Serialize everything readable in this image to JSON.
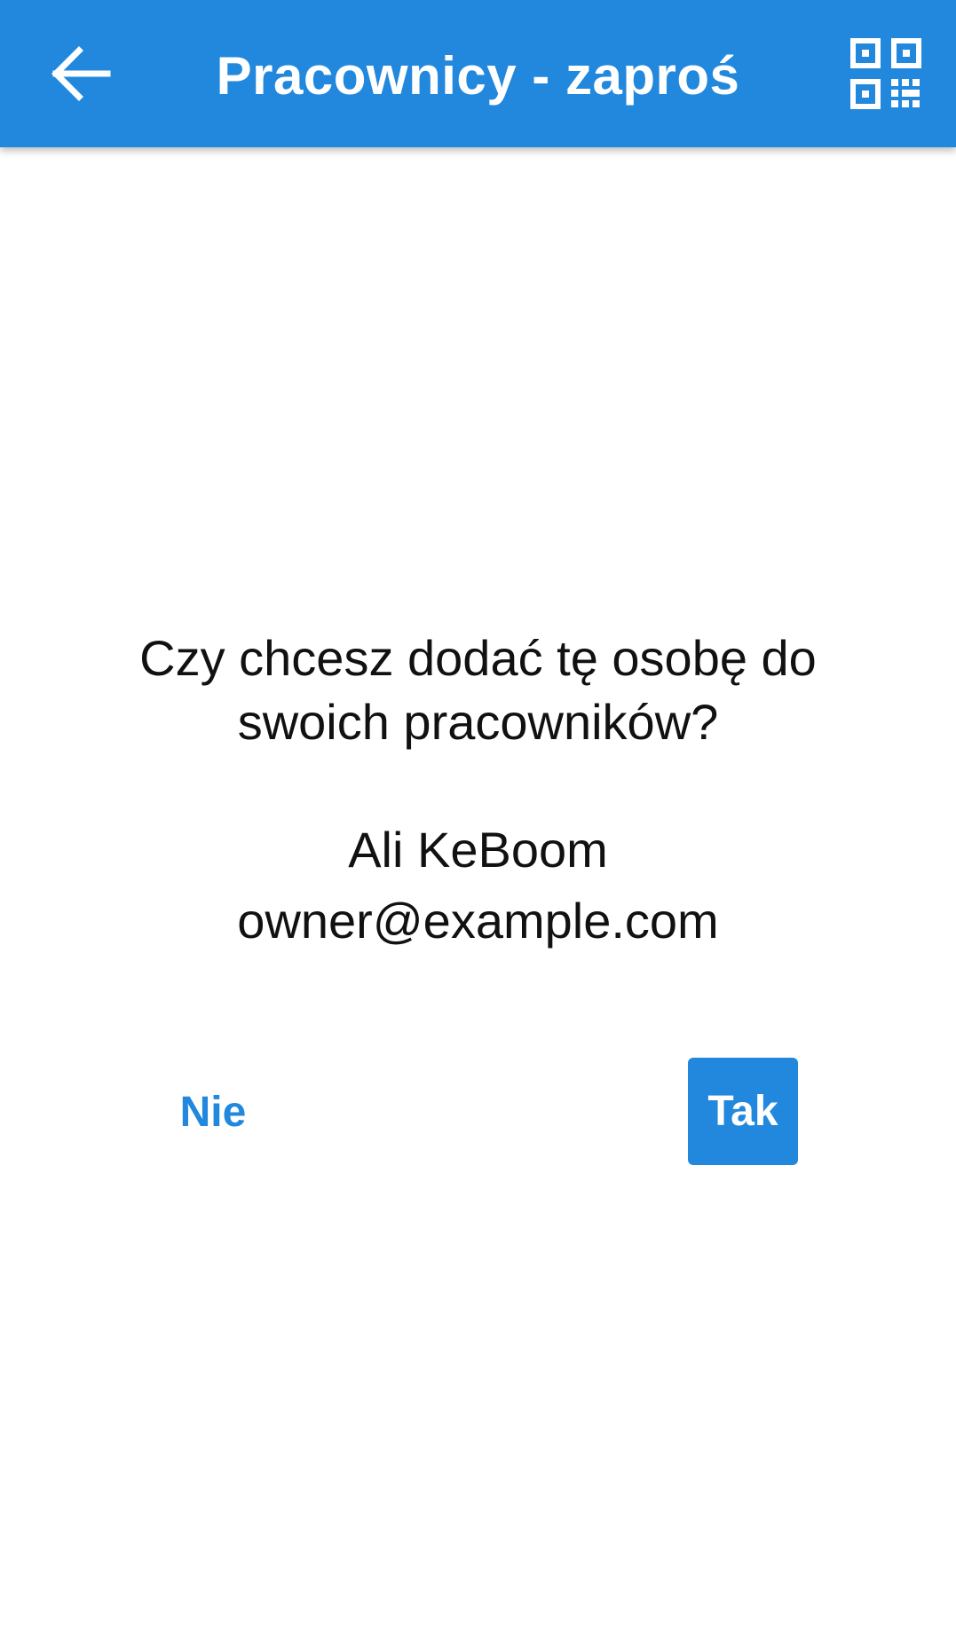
{
  "app_bar": {
    "title": "Pracownicy - zaproś",
    "back_icon": "arrow-left-icon",
    "qr_icon": "qr-code-icon",
    "background_color": "#2288dd",
    "text_color": "#ffffff"
  },
  "dialog": {
    "question": "Czy chcesz dodać tę osobę do swoich pracowników?",
    "person_name": "Ali KeBoom",
    "person_email": "owner@example.com",
    "no_label": "Nie",
    "yes_label": "Tak",
    "accent_color": "#2288dd"
  }
}
